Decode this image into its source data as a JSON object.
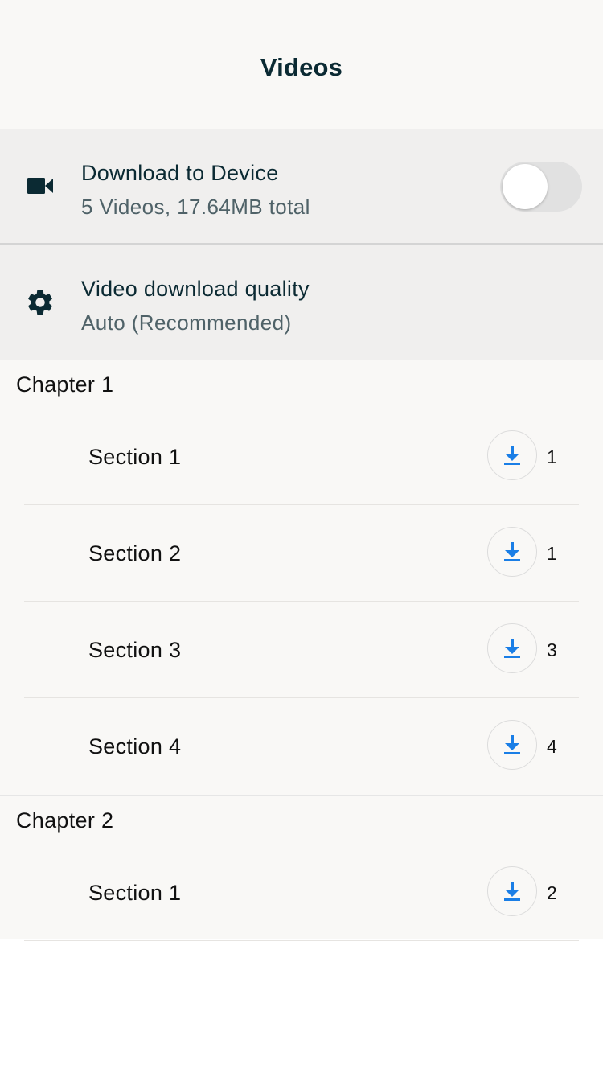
{
  "header": {
    "title": "Videos"
  },
  "download_setting": {
    "icon": "video-camera-icon",
    "title": "Download to Device",
    "subtitle": "5 Videos, 17.64MB total",
    "toggle_on": false
  },
  "quality_setting": {
    "icon": "gear-icon",
    "title": "Video download quality",
    "subtitle": "Auto (Recommended)"
  },
  "chapters": [
    {
      "title": "Chapter 1",
      "sections": [
        {
          "label": "Section 1",
          "count": "1"
        },
        {
          "label": "Section 2",
          "count": "1"
        },
        {
          "label": "Section 3",
          "count": "3"
        },
        {
          "label": "Section 4",
          "count": "4"
        }
      ]
    },
    {
      "title": "Chapter 2",
      "sections": [
        {
          "label": "Section 1",
          "count": "2"
        }
      ]
    }
  ],
  "colors": {
    "accent": "#1a7ee6",
    "title_text": "#0b2a33",
    "secondary_text": "#4f6268",
    "settings_bg": "#f0efee",
    "page_bg": "#f9f8f6"
  },
  "icons": {
    "download": "download-icon"
  }
}
